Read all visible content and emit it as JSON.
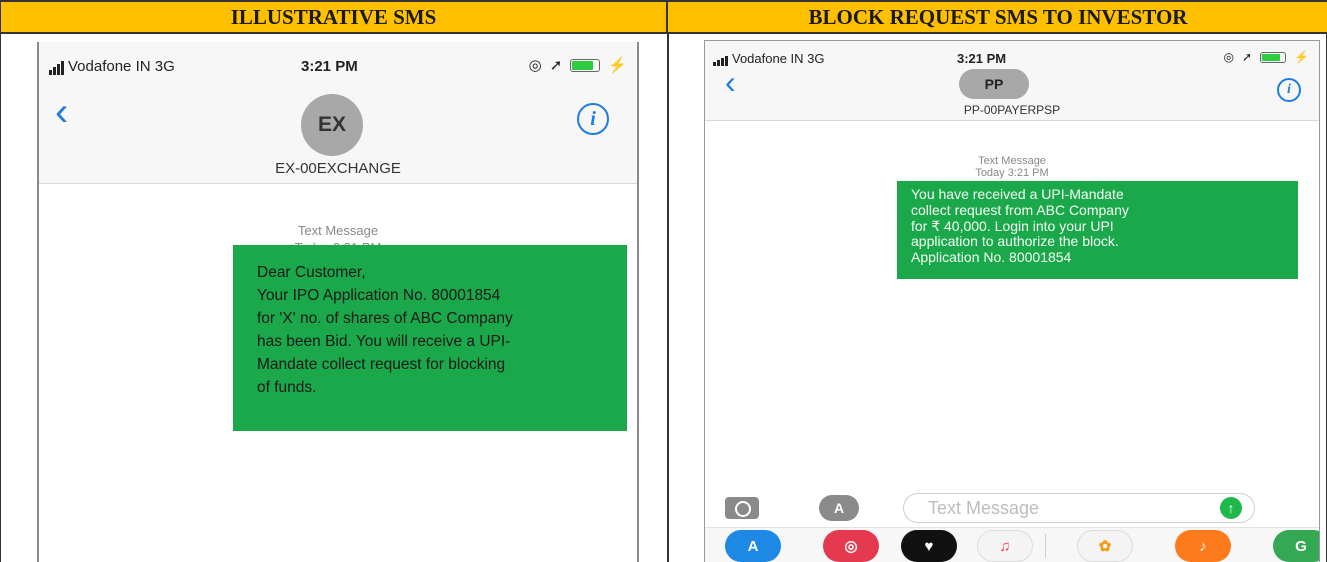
{
  "headers": {
    "left": "ILLUSTRATIVE SMS",
    "right": "BLOCK REQUEST SMS TO INVESTOR"
  },
  "left_phone": {
    "carrier": "Vodafone IN  3G",
    "time": "3:21 PM",
    "avatar": "EX",
    "sender": "EX-00EXCHANGE",
    "meta_type": "Text Message",
    "meta_time": "Today 3:21 PM",
    "message": "Dear Customer,\nYour IPO Application No. 80001854\nfor 'X' no. of shares of ABC Company\nhas been Bid. You will receive a UPI-\nMandate collect request for blocking\nof funds."
  },
  "right_phone": {
    "carrier": "Vodafone IN  3G",
    "time": "3:21 PM",
    "avatar": "PP",
    "sender": "PP-00PAYERPSP",
    "meta_type": "Text Message",
    "meta_time": "Today 3:21 PM",
    "message": "You have received a UPI-Mandate\ncollect request from ABC Company\nfor ₹ 40,000. Login into your UPI\napplication to authorize the block.\nApplication No. 80001854",
    "composer_placeholder": "Text Message"
  },
  "icons": {
    "back": "chevron-left-icon",
    "info": "info-icon",
    "camera": "camera-icon",
    "appstore": "app-store-icon",
    "send": "send-arrow-icon"
  },
  "colors": {
    "header_bg": "#ffc000",
    "bubble": "#1aa84b",
    "ios_blue": "#1d7de2"
  }
}
